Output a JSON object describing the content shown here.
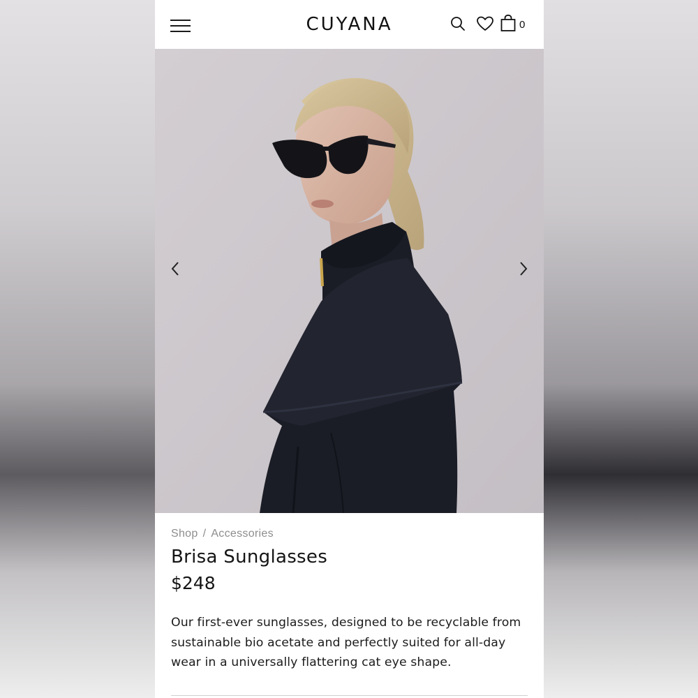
{
  "header": {
    "brand": "CUYANA",
    "cart_count": "0",
    "icons": [
      "menu-icon",
      "search-icon",
      "heart-icon",
      "bag-icon"
    ]
  },
  "gallery": {
    "image_subject": "model wearing cat eye sunglasses and black coat",
    "prev_icon": "chevron-left-icon",
    "next_icon": "chevron-right-icon"
  },
  "product": {
    "breadcrumb": [
      "Shop",
      "Accessories"
    ],
    "breadcrumb_separator": "/",
    "name": "Brisa Sunglasses",
    "price": "$248",
    "description": "Our first-ever sunglasses, designed to be recyclable from sustainable bio acetate and perfectly suited for all-day wear in a universally flattering cat eye shape."
  },
  "colors": {
    "text": "#151515",
    "muted": "#8d8d8d",
    "photo_bg": "#cdc8cc",
    "coat": "#1b1d26"
  }
}
